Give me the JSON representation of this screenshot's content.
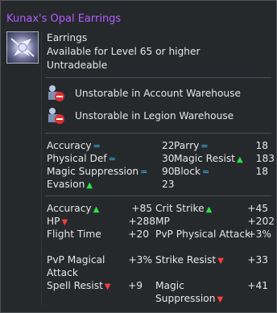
{
  "item": {
    "name": "Kunax's Opal Earrings",
    "type": "Earrings",
    "level_req": "Available for Level 65 or higher",
    "trade": "Untradeable",
    "icon": "opal-earring-icon",
    "title_color": "#b45cff"
  },
  "warehouse": {
    "account": "Unstorable in Account Warehouse",
    "legion": "Unstorable in Legion Warehouse",
    "icon": "no-warehouse-icon"
  },
  "base_stats": [
    {
      "name": "Accuracy",
      "value": "22",
      "marker": "="
    },
    {
      "name": "Parry",
      "value": "18",
      "marker": "="
    },
    {
      "name": "Physical Def",
      "value": "30",
      "marker": "="
    },
    {
      "name": "Magic Resist",
      "value": "183",
      "marker": "▲"
    },
    {
      "name": "Magic Suppression",
      "value": "90",
      "marker": "="
    },
    {
      "name": "Block",
      "value": "18",
      "marker": "="
    },
    {
      "name": "Evasion",
      "value": "23",
      "marker": "▲"
    }
  ],
  "bonus_stats": [
    {
      "name": "Accuracy",
      "value": "+85",
      "marker": "▲"
    },
    {
      "name": "Crit Strike",
      "value": "+45",
      "marker": "▲"
    },
    {
      "name": "HP",
      "value": "+288",
      "marker": "▼"
    },
    {
      "name": "MP",
      "value": "+202",
      "marker": ""
    },
    {
      "name": "Flight Time",
      "value": "+20",
      "marker": ""
    },
    {
      "name": "PvP Physical Attack",
      "value": "+3%",
      "marker": ""
    },
    {
      "name": "PvP Magical",
      "name2": "Attack",
      "value": "+3%",
      "marker": ""
    },
    {
      "name": "Strike Resist",
      "value": "+33",
      "marker": "▼"
    },
    {
      "name": "Spell Resist",
      "value": "+9",
      "marker": "▼"
    },
    {
      "name": "Magic",
      "name2": "Suppression",
      "value": "+41",
      "marker": "▼"
    }
  ],
  "colors": {
    "equal": "#38c2ff",
    "up": "#27e244",
    "down": "#ff3b3b"
  }
}
